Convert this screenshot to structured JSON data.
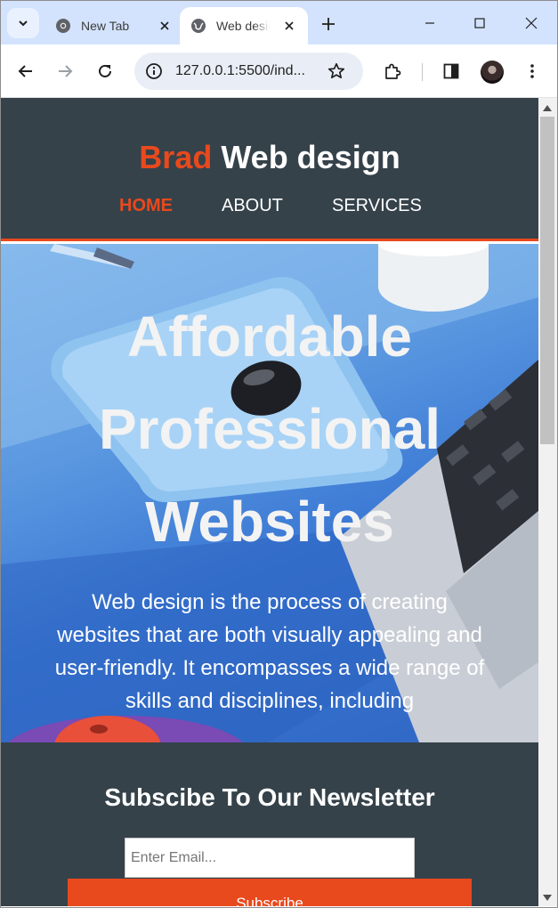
{
  "browser": {
    "tabs": [
      {
        "title": "New Tab",
        "favicon": "chrome-icon",
        "active": false
      },
      {
        "title": "Web design",
        "favicon": "globe-icon",
        "active": true
      }
    ],
    "address": "127.0.0.1:5500/ind...",
    "colors": {
      "tabstrip": "#d3e3fd",
      "omnibox": "#e9eef6"
    }
  },
  "site": {
    "logo_accent": "Brad",
    "logo_rest": "Web design",
    "nav": [
      {
        "label": "HOME",
        "current": true
      },
      {
        "label": "ABOUT",
        "current": false
      },
      {
        "label": "SERVICES",
        "current": false
      }
    ],
    "hero": {
      "title_lines": [
        "Affordable",
        "Professional",
        "Websites"
      ],
      "text": "Web design is the process of creating websites that are both visually appealing and user-friendly. It encompasses a wide range of skills and disciplines, including"
    },
    "newsletter": {
      "title": "Subscibe To Our Newsletter",
      "placeholder": "Enter Email...",
      "button": "Subscribe"
    },
    "colors": {
      "dark": "#35424a",
      "accent": "#e8491d"
    }
  }
}
